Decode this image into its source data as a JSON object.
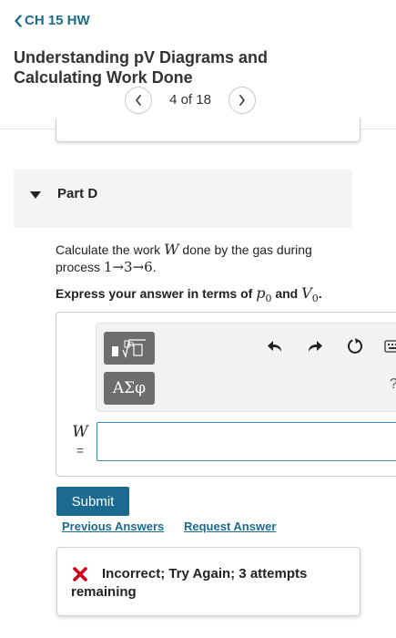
{
  "header": {
    "back_label": "CH 15 HW",
    "title": "Understanding pV Diagrams and Calculating Work Done",
    "pager_text": "4 of 18"
  },
  "part": {
    "label": "Part D"
  },
  "question": {
    "text_before": "Calculate the work ",
    "var_W": "W",
    "text_after": " done by the gas during process ",
    "process": "1→3→6",
    "period": ".",
    "instruction_before": "Express your answer in terms of ",
    "p0": "p",
    "p0_sub": "0",
    "instruction_and": " and ",
    "V0": "V",
    "V0_sub": "0",
    "instruction_end": "."
  },
  "toolbar": {
    "symbols_label": "ΑΣφ",
    "help_label": "?"
  },
  "answer": {
    "variable": "W",
    "equals": "=",
    "value": ""
  },
  "actions": {
    "submit_label": "Submit",
    "previous_answers_label": "Previous Answers",
    "request_answer_label": "Request Answer"
  },
  "feedback": {
    "message": "Incorrect; Try Again; 3 attempts remaining",
    "status_color": "#d0021b"
  },
  "colors": {
    "accent": "#1a6b8f",
    "toolbar_button": "#6d6d6d"
  }
}
